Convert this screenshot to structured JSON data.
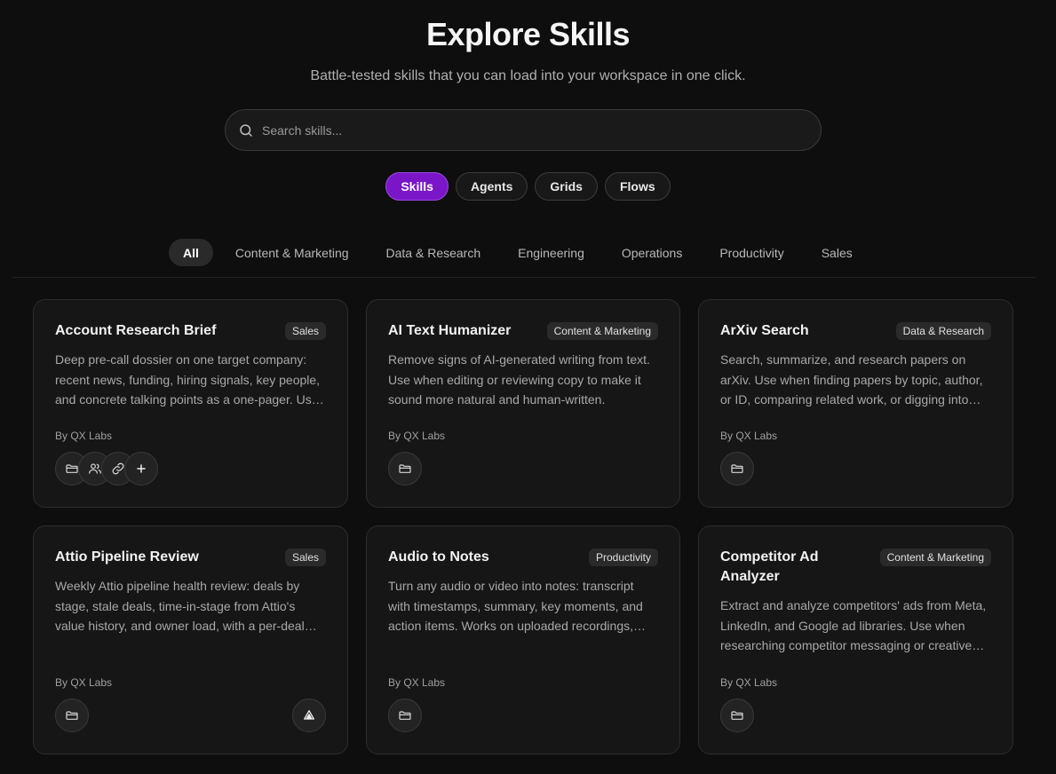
{
  "header": {
    "title": "Explore Skills",
    "subtitle": "Battle-tested skills that you can load into your workspace in one click."
  },
  "search": {
    "placeholder": "Search skills...",
    "value": "",
    "icon": "search-icon"
  },
  "type_tabs": [
    {
      "label": "Skills",
      "active": true
    },
    {
      "label": "Agents",
      "active": false
    },
    {
      "label": "Grids",
      "active": false
    },
    {
      "label": "Flows",
      "active": false
    }
  ],
  "category_tabs": [
    {
      "label": "All",
      "active": true
    },
    {
      "label": "Content & Marketing",
      "active": false
    },
    {
      "label": "Data & Research",
      "active": false
    },
    {
      "label": "Engineering",
      "active": false
    },
    {
      "label": "Operations",
      "active": false
    },
    {
      "label": "Productivity",
      "active": false
    },
    {
      "label": "Sales",
      "active": false
    }
  ],
  "cards": [
    {
      "title": "Account Research Brief",
      "badge": "Sales",
      "description": "Deep pre-call dossier on one target company: recent news, funding, hiring signals, key people, and concrete talking points as a one-pager. Use before sales calls.",
      "author": "By QX Labs",
      "icons": [
        "folder-icon",
        "users-icon",
        "link-icon",
        "plus-icon"
      ]
    },
    {
      "title": "AI Text Humanizer",
      "badge": "Content & Marketing",
      "description": "Remove signs of AI-generated writing from text. Use when editing or reviewing copy to make it sound more natural and human-written.",
      "author": "By QX Labs",
      "icons": [
        "folder-icon"
      ]
    },
    {
      "title": "ArXiv Search",
      "badge": "Data & Research",
      "description": "Search, summarize, and research papers on arXiv. Use when finding papers by topic, author, or ID, comparing related work, or digging into details.",
      "author": "By QX Labs",
      "icons": [
        "folder-icon"
      ]
    },
    {
      "title": "Attio Pipeline Review",
      "badge": "Sales",
      "description": "Weekly Attio pipeline health review: deals by stage, stale deals, time-in-stage from Attio's value history, and owner load, with a per-deal summary.",
      "author": "By QX Labs",
      "icons": [
        "folder-icon"
      ],
      "right_icon": "attio-icon"
    },
    {
      "title": "Audio to Notes",
      "badge": "Productivity",
      "description": "Turn any audio or video into notes: transcript with timestamps, summary, key moments, and action items. Works on uploaded recordings, links, and files.",
      "author": "By QX Labs",
      "icons": [
        "folder-icon"
      ]
    },
    {
      "title": "Competitor Ad Analyzer",
      "badge": "Content & Marketing",
      "description": "Extract and analyze competitors' ads from Meta, LinkedIn, and Google ad libraries. Use when researching competitor messaging or creative strategy.",
      "author": "By QX Labs",
      "icons": [
        "folder-icon"
      ]
    }
  ],
  "colors": {
    "background": "#0e0e0e",
    "card": "#161616",
    "accent": "#7a16c8"
  }
}
